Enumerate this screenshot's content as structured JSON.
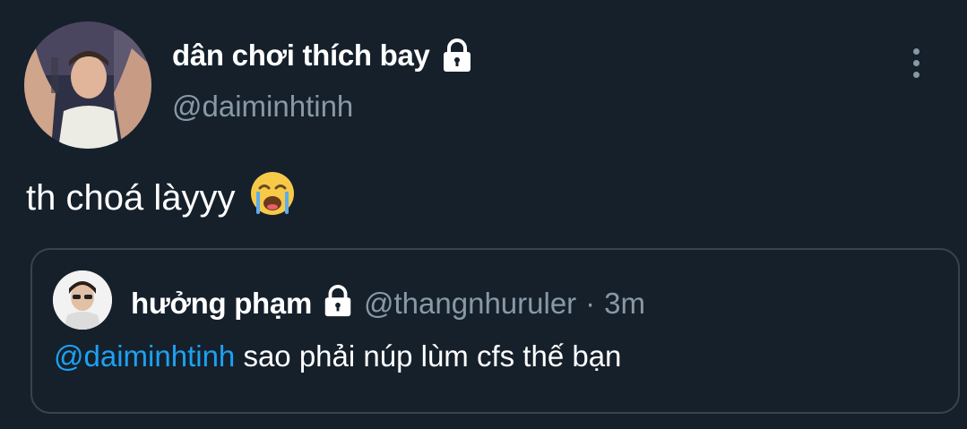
{
  "tweet": {
    "author": {
      "display_name": "dân chơi thích bay",
      "handle": "@daiminhtinh",
      "avatar_icon": "avatar-photo",
      "lock_icon": "lock-icon"
    },
    "more_icon": "more-vertical-icon",
    "text": "th choá làyyy",
    "emoji": "loudly-crying-face-icon",
    "quote": {
      "author": {
        "display_name": "hưởng phạm",
        "handle": "@thangnhuruler",
        "separator": "·",
        "time": "3m",
        "lock_icon": "lock-icon"
      },
      "mention": "@daiminhtinh",
      "text": "sao phải núp lùm cfs thế bạn"
    }
  },
  "colors": {
    "background": "#15202b",
    "primary_text": "#ffffff",
    "secondary_text": "#8899a6",
    "mention": "#1da1f2",
    "border": "#38444d"
  }
}
